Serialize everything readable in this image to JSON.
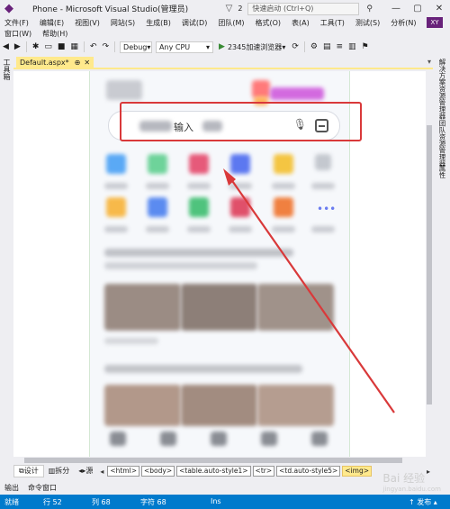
{
  "window": {
    "title": "Phone - Microsoft Visual Studio(管理员)",
    "notif_count": "2",
    "quick_launch_placeholder": "快速启动 (Ctrl+Q)",
    "minimize": "—",
    "restore": "▢",
    "close": "✕",
    "user_initials": "XY"
  },
  "menu": {
    "row1": [
      "文件(F)",
      "编辑(E)",
      "视图(V)",
      "网站(S)",
      "生成(B)",
      "调试(D)",
      "团队(M)",
      "格式(O)",
      "表(A)",
      "工具(T)",
      "测试(S)",
      "分析(N)"
    ],
    "row2": [
      "窗口(W)",
      "帮助(H)"
    ]
  },
  "toolbar": {
    "config": "Debug",
    "platform": "Any CPU",
    "run_label": "2345加速浏览器"
  },
  "sidebars": {
    "left": "工具箱",
    "right1": "解决方案资源管理器",
    "right2": "团队资源管理器",
    "right3": "属性"
  },
  "document": {
    "tab_label": "Default.aspx*",
    "pin": "⊕",
    "close": "✕",
    "search_prompt": "输入"
  },
  "bottom": {
    "views": [
      "设计",
      "拆分",
      "源"
    ],
    "breadcrumbs": [
      "<html>",
      "<body>",
      "<table.auto-style1>",
      "<tr>",
      "<td.auto-style5>",
      "<img>"
    ]
  },
  "output": {
    "tabs": [
      "输出",
      "命令窗口"
    ]
  },
  "status": {
    "ready": "就绪",
    "line": "行 52",
    "col": "列 68",
    "char": "字符 68",
    "ins": "Ins",
    "publish": "↑ 发布 ▴"
  },
  "watermark": {
    "main": "Bai 经验",
    "sub": "jingyan.baidu.com"
  },
  "colors": {
    "vs_purple": "#68217a",
    "status_blue": "#007acc",
    "tab_yellow": "#ffe98c",
    "annotation_red": "#d9393a"
  }
}
